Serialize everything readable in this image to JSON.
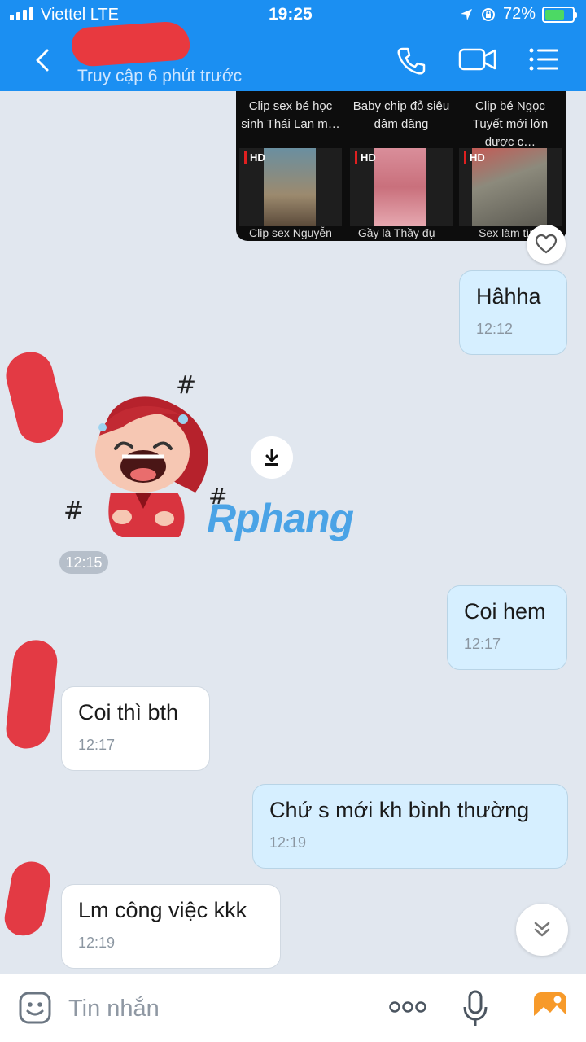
{
  "status_bar": {
    "carrier": "Viettel  LTE",
    "time": "19:25",
    "battery": "72%",
    "battery_level": 0.72,
    "icons": [
      "signal-icon",
      "location-icon",
      "orientation-lock-icon",
      "battery-icon"
    ]
  },
  "header": {
    "last_seen": "Truy cập 6 phút trước",
    "icons": [
      "back-icon",
      "phone-icon",
      "video-icon",
      "menu-icon"
    ]
  },
  "shared_media": {
    "titles": [
      "Clip sex bé học sinh Thái Lan m…",
      "Baby chip đỏ siêu dâm đãng",
      "Clip bé Ngọc Tuyết mới lớn được c…"
    ],
    "thumbs": [
      {
        "badge": "HD",
        "caption": "Clip sex Nguyễn"
      },
      {
        "badge": "HD",
        "caption": "Gầy là Thầy đụ –"
      },
      {
        "badge": "HD",
        "caption": "Sex làm tình"
      }
    ]
  },
  "messages": [
    {
      "direction": "out",
      "text": "Hâhha",
      "time": "12:12"
    },
    {
      "direction": "in",
      "type": "sticker",
      "time": "12:15",
      "watermark": "Rphang"
    },
    {
      "direction": "out",
      "text": "Coi hem",
      "time": "12:17"
    },
    {
      "direction": "in",
      "text": "Coi thì bth",
      "time": "12:17"
    },
    {
      "direction": "out",
      "text": "Chứ s mới kh bình thường",
      "time": "12:19"
    },
    {
      "direction": "in",
      "text": "Lm công việc kkk",
      "time": "12:19"
    }
  ],
  "composer": {
    "placeholder": "Tin nhắn",
    "icons": [
      "emoji-icon",
      "more-icon",
      "microphone-icon",
      "image-icon"
    ]
  },
  "colors": {
    "header": "#1b8ff2",
    "outgoing_bubble": "#d6efff",
    "incoming_bubble": "#ffffff",
    "background": "#e1e7ef",
    "watermark": "#4aa3e6"
  }
}
